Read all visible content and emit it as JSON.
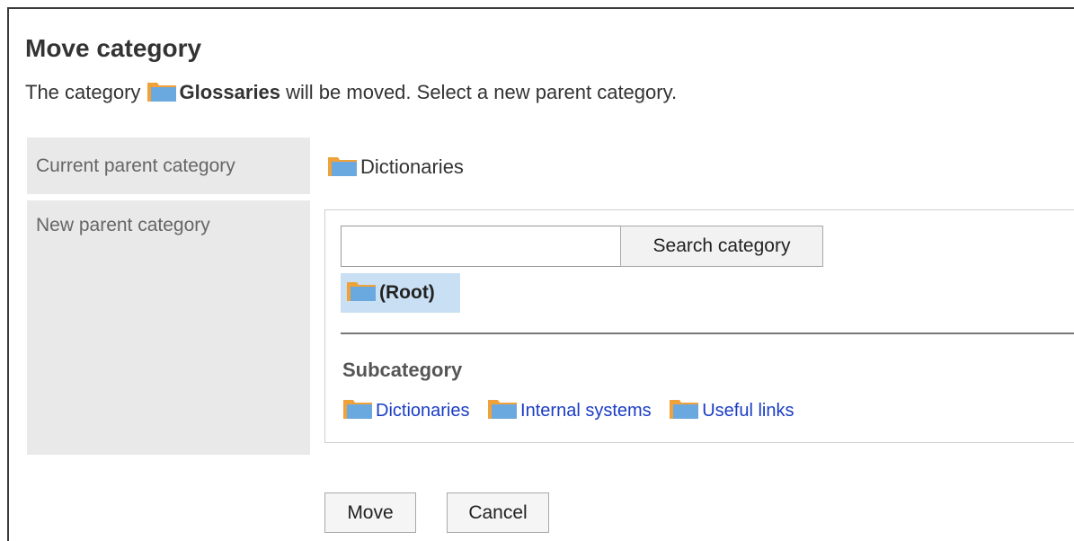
{
  "page": {
    "title": "Move category",
    "desc_prefix": "The category ",
    "desc_category": "Glossaries",
    "desc_suffix": " will be moved. Select a new parent category."
  },
  "form": {
    "current_label": "Current parent category",
    "current_value": "Dictionaries",
    "new_label": "New parent category",
    "search": {
      "value": "",
      "placeholder": "",
      "button_label": "Search category"
    },
    "selected": "(Root)",
    "subcategory_title": "Subcategory",
    "subcategories": [
      {
        "label": "Dictionaries"
      },
      {
        "label": "Internal systems"
      },
      {
        "label": "Useful links"
      }
    ]
  },
  "actions": {
    "move_label": "Move",
    "cancel_label": "Cancel"
  },
  "icons": {
    "folder": "folder-icon"
  },
  "colors": {
    "folder_body": "#6aa8e0",
    "folder_tab": "#f0a23a",
    "selected_bg": "#c9dff3",
    "link": "#1a3dc4"
  }
}
